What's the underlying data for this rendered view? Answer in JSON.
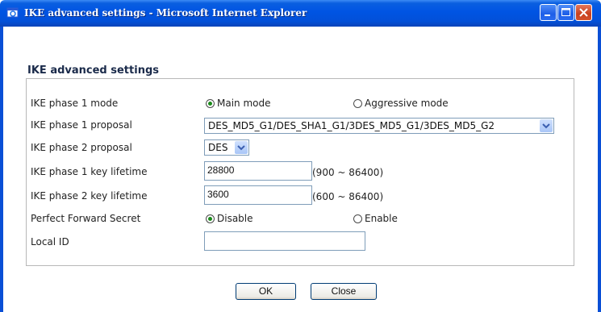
{
  "window": {
    "title": "IKE advanced settings - Microsoft Internet Explorer",
    "title_icon": "ie-icon",
    "controls": [
      "minimize-icon",
      "maximize-icon",
      "close-icon"
    ]
  },
  "page": {
    "heading": "IKE advanced settings"
  },
  "form": {
    "phase1_mode": {
      "label": "IKE phase 1 mode",
      "options": [
        "Main mode",
        "Aggressive mode"
      ],
      "selected": "Main mode"
    },
    "phase1_proposal": {
      "label": "IKE phase 1 proposal",
      "value": "DES_MD5_G1/DES_SHA1_G1/3DES_MD5_G1/3DES_MD5_G2"
    },
    "phase2_proposal": {
      "label": "IKE phase 2 proposal",
      "value": "DES"
    },
    "phase1_lifetime": {
      "label": "IKE phase 1 key lifetime",
      "value": "28800",
      "range": "(900 ~ 86400)"
    },
    "phase2_lifetime": {
      "label": "IKE phase 2 key lifetime",
      "value": "3600",
      "range": "(600 ~ 86400)"
    },
    "pfs": {
      "label": "Perfect Forward Secret",
      "options": [
        "Disable",
        "Enable"
      ],
      "selected": "Disable"
    },
    "local_id": {
      "label": "Local ID",
      "value": ""
    }
  },
  "buttons": {
    "ok": "OK",
    "close": "Close"
  },
  "colors": {
    "titlebar": "#0054e3",
    "close_button": "#c8401e",
    "radio_selected": "#1a8a1a"
  }
}
